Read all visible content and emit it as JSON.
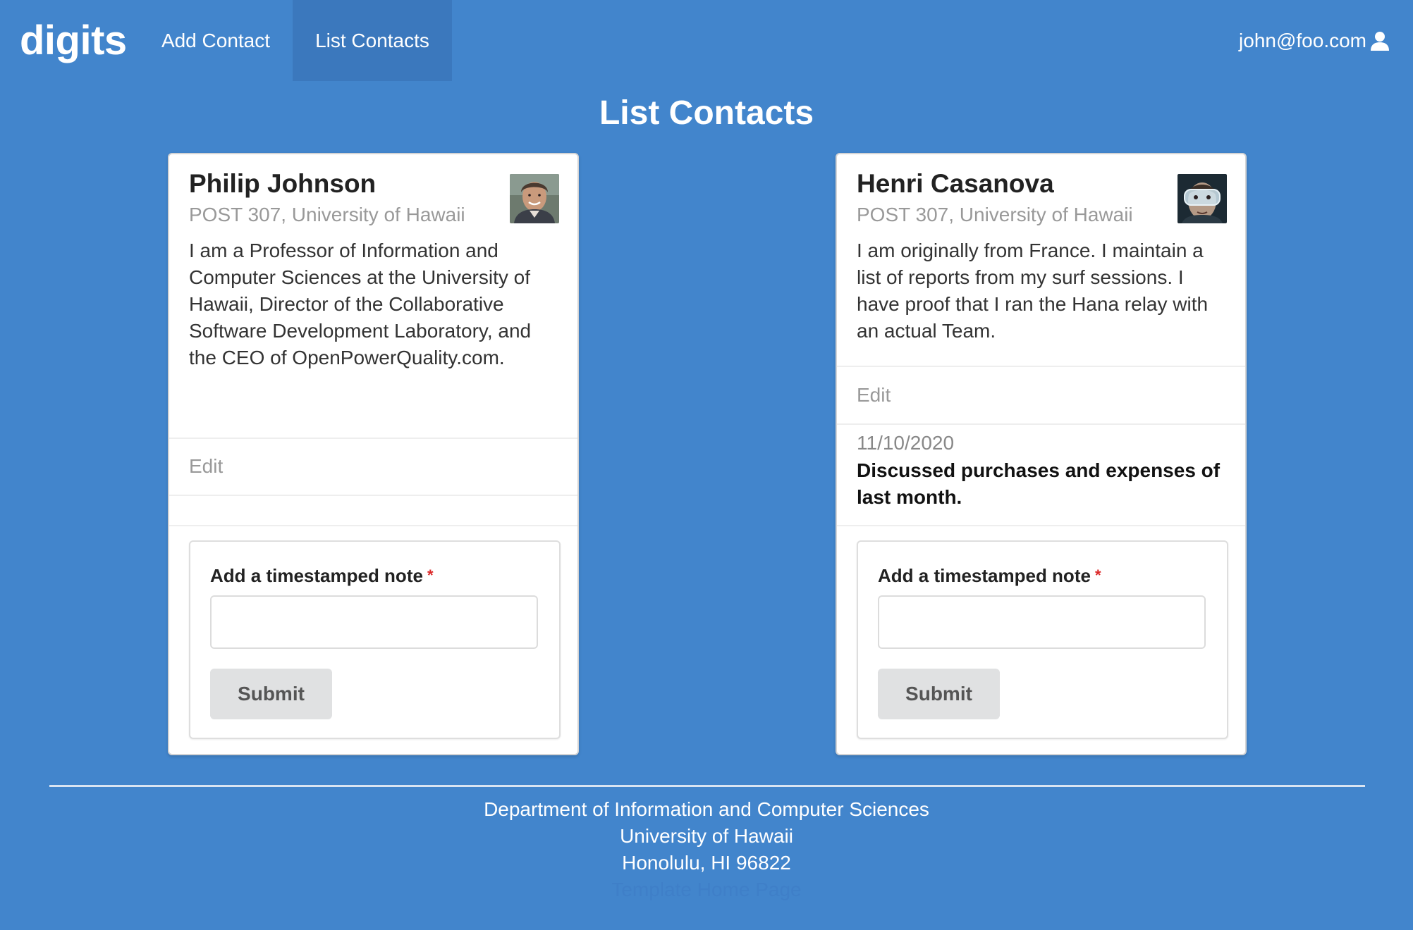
{
  "nav": {
    "brand": "digits",
    "add_contact": "Add Contact",
    "list_contacts": "List Contacts",
    "user": "john@foo.com"
  },
  "page": {
    "title": "List Contacts"
  },
  "contacts": [
    {
      "name": "Philip Johnson",
      "address": "POST 307, University of Hawaii",
      "description": "I am a Professor of Information and Computer Sciences at the University of Hawaii, Director of the Collaborative Software Development Laboratory, and the CEO of OpenPowerQuality.com.",
      "edit": "Edit",
      "notes": [],
      "form": {
        "label": "Add a timestamped note",
        "required_mark": "*",
        "input_value": "",
        "submit": "Submit"
      }
    },
    {
      "name": "Henri Casanova",
      "address": "POST 307, University of Hawaii",
      "description": "I am originally from France. I maintain a list of reports from my surf sessions. I have proof that I ran the Hana relay with an actual Team.",
      "edit": "Edit",
      "notes": [
        {
          "date": "11/10/2020",
          "text": "Discussed purchases and expenses of last month."
        }
      ],
      "form": {
        "label": "Add a timestamped note",
        "required_mark": "*",
        "input_value": "",
        "submit": "Submit"
      }
    }
  ],
  "footer": {
    "line1": "Department of Information and Computer Sciences",
    "line2": "University of Hawaii",
    "line3": "Honolulu, HI 96822",
    "link": "Template Home Page"
  },
  "colors": {
    "background": "#4285cc",
    "nav_active": "#3b78bd",
    "required": "#db2828",
    "button": "#e0e1e2"
  },
  "icons": {
    "user": "user-icon"
  }
}
